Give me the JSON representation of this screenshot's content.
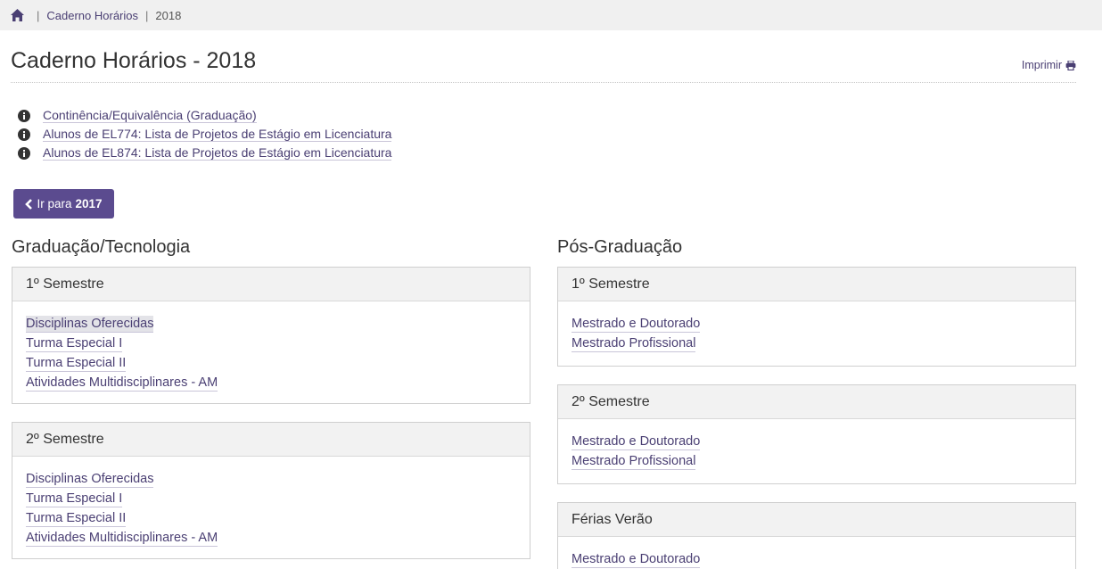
{
  "breadcrumb": {
    "items": [
      "Caderno Horários",
      "2018"
    ]
  },
  "header": {
    "title": "Caderno Horários - 2018",
    "print_label": "Imprimir"
  },
  "info_links": [
    "Continência/Equivalência (Graduação)",
    "Alunos de EL774: Lista de Projetos de Estágio em Licenciatura",
    "Alunos de EL874: Lista de Projetos de Estágio em Licenciatura"
  ],
  "nav": {
    "prev_prefix": "Ir para",
    "prev_year": "2017"
  },
  "graduacao": {
    "title": "Graduação/Tecnologia",
    "panels": [
      {
        "heading": "1º Semestre",
        "links": [
          "Disciplinas Oferecidas",
          "Turma Especial I",
          "Turma Especial II",
          "Atividades Multidisciplinares - AM"
        ]
      },
      {
        "heading": "2º Semestre",
        "links": [
          "Disciplinas Oferecidas",
          "Turma Especial I",
          "Turma Especial II",
          "Atividades Multidisciplinares - AM"
        ]
      }
    ]
  },
  "pos": {
    "title": "Pós-Graduação",
    "panels": [
      {
        "heading": "1º Semestre",
        "links": [
          "Mestrado e Doutorado",
          "Mestrado Profissional"
        ]
      },
      {
        "heading": "2º Semestre",
        "links": [
          "Mestrado e Doutorado",
          "Mestrado Profissional"
        ]
      },
      {
        "heading": "Férias Verão",
        "links": [
          "Mestrado e Doutorado"
        ]
      }
    ]
  },
  "colors": {
    "accent": "#5b4b8f",
    "link": "#4a3f73",
    "breadcrumb_bg": "#f0f0f0",
    "panel_head_bg": "#f2f2f2"
  }
}
